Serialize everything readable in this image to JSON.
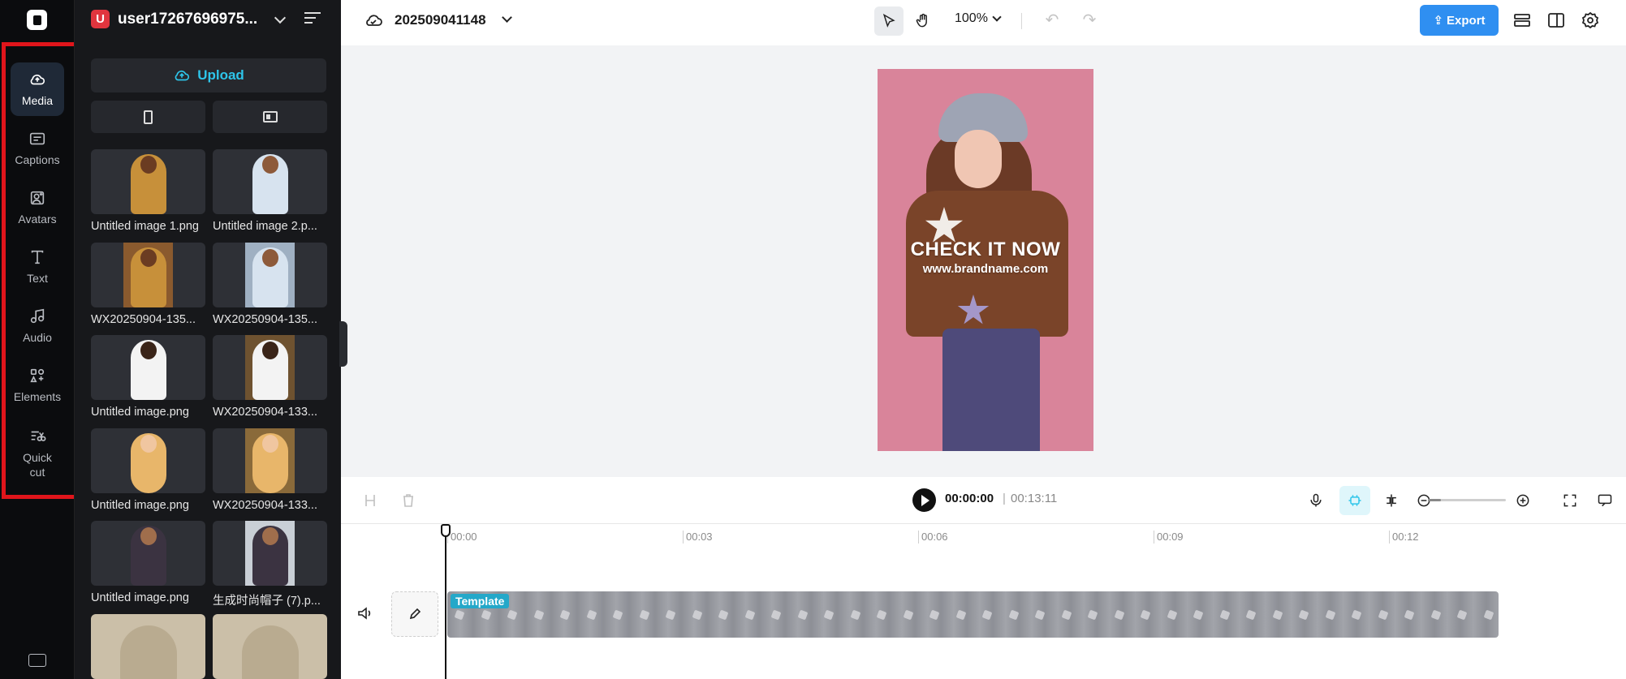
{
  "rail": {
    "items": [
      {
        "label": "Media",
        "icon": "cloud-upload-icon",
        "active": true
      },
      {
        "label": "Captions",
        "icon": "captions-icon"
      },
      {
        "label": "Avatars",
        "icon": "avatar-icon"
      },
      {
        "label": "Text",
        "icon": "text-icon"
      },
      {
        "label": "Audio",
        "icon": "music-note-icon"
      },
      {
        "label": "Elements",
        "icon": "elements-icon"
      },
      {
        "label": "Quick cut",
        "icon": "quick-cut-icon"
      }
    ],
    "highlight_color": "#e0151b"
  },
  "panel": {
    "user": {
      "initial": "U",
      "name": "user17267696975..."
    },
    "upload_label": "Upload",
    "media": [
      {
        "caption": "Untitled image 1.png"
      },
      {
        "caption": "Untitled image 2.p..."
      },
      {
        "caption": "WX20250904-135..."
      },
      {
        "caption": "WX20250904-135..."
      },
      {
        "caption": "Untitled image.png"
      },
      {
        "caption": "WX20250904-133..."
      },
      {
        "caption": "Untitled image.png"
      },
      {
        "caption": "WX20250904-133..."
      },
      {
        "caption": "Untitled image.png"
      },
      {
        "caption": "生成时尚帽子 (7).p..."
      },
      {
        "caption": ""
      },
      {
        "caption": ""
      }
    ]
  },
  "topbar": {
    "project_name": "202509041148",
    "zoom": "100%",
    "export_label": "Export",
    "accent": "#2f8ff1"
  },
  "preview": {
    "headline": "CHECK IT NOW",
    "url": "www.brandname.com",
    "bg_color": "#d9849a"
  },
  "player": {
    "current_time": "00:00:00",
    "separator": "|",
    "total_time": "00:13:11"
  },
  "timeline": {
    "ruler": [
      "00:00",
      "00:03",
      "00:06",
      "00:09",
      "00:12"
    ],
    "clip_label": "Template"
  }
}
